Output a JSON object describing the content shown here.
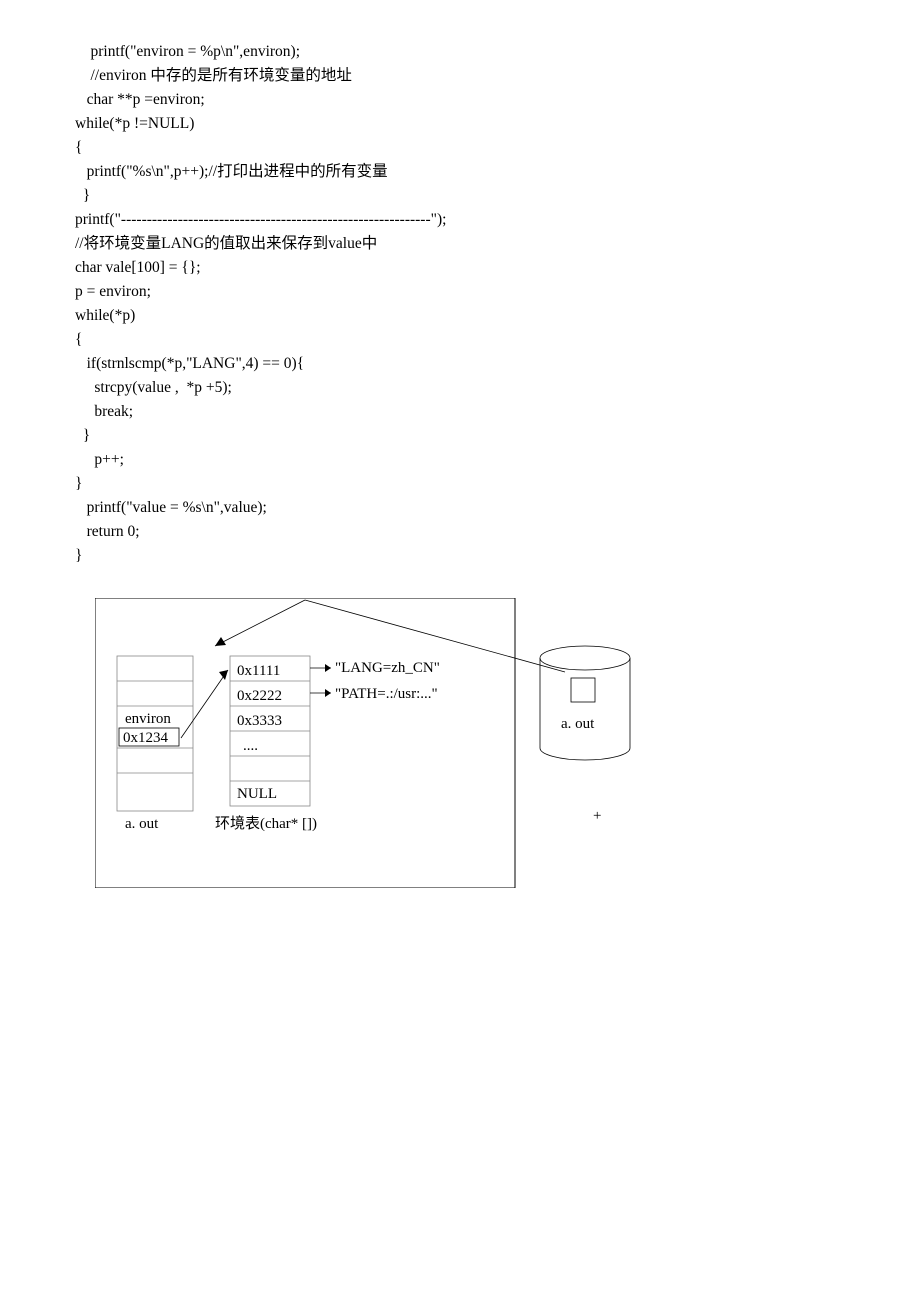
{
  "code": {
    "lines": [
      "    printf(\"environ = %p\\n\",environ);",
      "    //environ 中存的是所有环境变量的地址",
      "   char **p =environ;",
      "while(*p !=NULL)",
      "{",
      "   printf(\"%s\\n\",p++);//打印出进程中的所有变量",
      "  }",
      "printf(\"------------------------------------------------------------\");",
      "//将环境变量LANG的值取出来保存到value中",
      "char vale[100] = {};",
      "p = environ;",
      "while(*p)",
      "{",
      "   if(strnlscmp(*p,\"LANG\",4) == 0){",
      "     strcpy(value ,  *p +5);",
      "     break;",
      "  }",
      "     p++;",
      "}",
      "   printf(\"value = %s\\n\",value);",
      "   return 0;",
      "}"
    ]
  },
  "diagram": {
    "left_box": {
      "label": "environ",
      "value": "0x1234",
      "caption": "a. out"
    },
    "env_table": {
      "rows": [
        "0x1111",
        "0x2222",
        "0x3333",
        "....",
        "NULL"
      ],
      "caption": "环境表(char* [])"
    },
    "env_strings": [
      "\"LANG=zh_CN\"",
      "\"PATH=.:/usr:...\""
    ],
    "cylinder_caption": "a. out",
    "plus": "+"
  }
}
